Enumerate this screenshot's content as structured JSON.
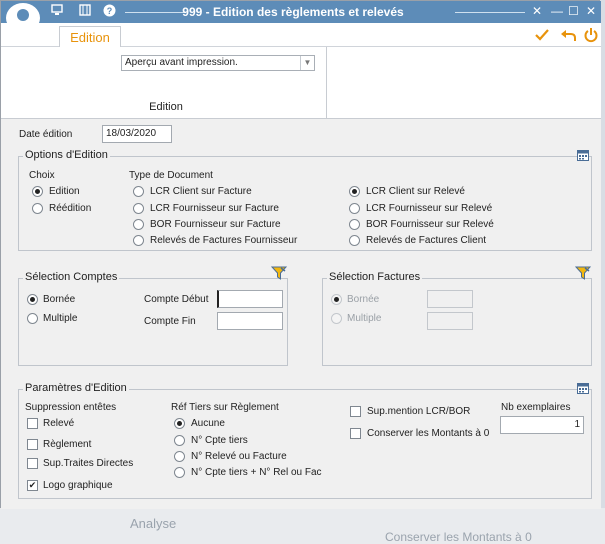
{
  "window": {
    "title": "999 - Edition des règlements et relevés"
  },
  "tabs": {
    "active": "Edition"
  },
  "ribbon": {
    "preview_select": "Aperçu avant impression.",
    "group_label": "Edition"
  },
  "date": {
    "label": "Date édition",
    "value": "18/03/2020"
  },
  "options": {
    "title": "Options d'Edition",
    "choix_label": "Choix",
    "choix": [
      {
        "label": "Edition",
        "checked": true
      },
      {
        "label": "Réédition",
        "checked": false
      }
    ],
    "type_label": "Type de Document",
    "types_left": [
      {
        "label": "LCR Client sur Facture"
      },
      {
        "label": "LCR Fournisseur sur Facture"
      },
      {
        "label": "BOR Fournisseur sur Facture"
      },
      {
        "label": "Relevés de Factures Fournisseur"
      }
    ],
    "types_right": [
      {
        "label": "LCR Client sur Relevé",
        "checked": true
      },
      {
        "label": "LCR Fournisseur sur Relevé"
      },
      {
        "label": "BOR Fournisseur sur Relevé"
      },
      {
        "label": "Relevés de Factures Client"
      }
    ]
  },
  "comptes": {
    "title": "Sélection Comptes",
    "radios": [
      {
        "label": "Bornée",
        "checked": true
      },
      {
        "label": "Multiple",
        "checked": false
      }
    ],
    "debut_label": "Compte Début",
    "fin_label": "Compte Fin",
    "debut_value": "",
    "fin_value": ""
  },
  "factures": {
    "title": "Sélection Factures",
    "radios": [
      {
        "label": "Bornée"
      },
      {
        "label": "Multiple"
      }
    ]
  },
  "params": {
    "title": "Paramètres d'Edition",
    "suppression_label": "Suppression entêtes",
    "suppression": [
      {
        "label": "Relevé",
        "checked": false
      },
      {
        "label": "Règlement",
        "checked": false
      },
      {
        "label": "Sup.Traites Directes",
        "checked": false
      },
      {
        "label": "Logo graphique",
        "checked": true
      }
    ],
    "ref_label": "Réf Tiers sur Règlement",
    "ref": [
      {
        "label": "Aucune",
        "checked": true
      },
      {
        "label": "N° Cpte tiers"
      },
      {
        "label": "N° Relevé ou Facture"
      },
      {
        "label": "N° Cpte tiers + N° Rel ou Fac"
      }
    ],
    "sup_mention": "Sup.mention LCR/BOR",
    "conserver": "Conserver les Montants à 0",
    "nb_label": "Nb exemplaires",
    "nb_value": "1"
  },
  "background": {
    "ghost1": "Analyse",
    "ghost2": "Conserver les Montants à 0"
  }
}
